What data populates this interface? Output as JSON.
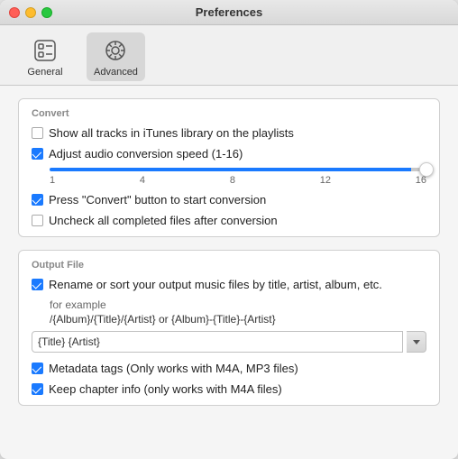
{
  "window": {
    "title": "Preferences"
  },
  "toolbar": {
    "items": [
      {
        "id": "general",
        "label": "General",
        "active": false
      },
      {
        "id": "advanced",
        "label": "Advanced",
        "active": true
      }
    ]
  },
  "convert_section": {
    "label": "Convert",
    "options": [
      {
        "id": "show-all-tracks",
        "label": "Show all tracks in iTunes library on the playlists",
        "checked": false
      },
      {
        "id": "adjust-audio",
        "label": "Adjust audio conversion speed (1-16)",
        "checked": true
      },
      {
        "id": "press-convert",
        "label": "Press \"Convert\" button to start conversion",
        "checked": true
      },
      {
        "id": "uncheck-completed",
        "label": "Uncheck all completed files after conversion",
        "checked": false
      }
    ],
    "slider": {
      "min": 1,
      "max": 16,
      "value": 16,
      "labels": [
        "1",
        "4",
        "8",
        "12",
        "16"
      ]
    }
  },
  "output_section": {
    "label": "Output File",
    "rename_option": {
      "id": "rename-sort",
      "label": "Rename or sort your output music files by title, artist, album, etc.",
      "checked": true
    },
    "example_label": "for example",
    "format_example": "/{Album}/{Title}/{Artist} or {Album}-{Title}-{Artist}",
    "input_value": "{Title} {Artist}",
    "metadata_option": {
      "id": "metadata-tags",
      "label": "Metadata tags (Only works with M4A, MP3 files)",
      "checked": true
    },
    "chapter_option": {
      "id": "keep-chapter",
      "label": "Keep chapter info (only works with  M4A files)",
      "checked": true
    }
  }
}
